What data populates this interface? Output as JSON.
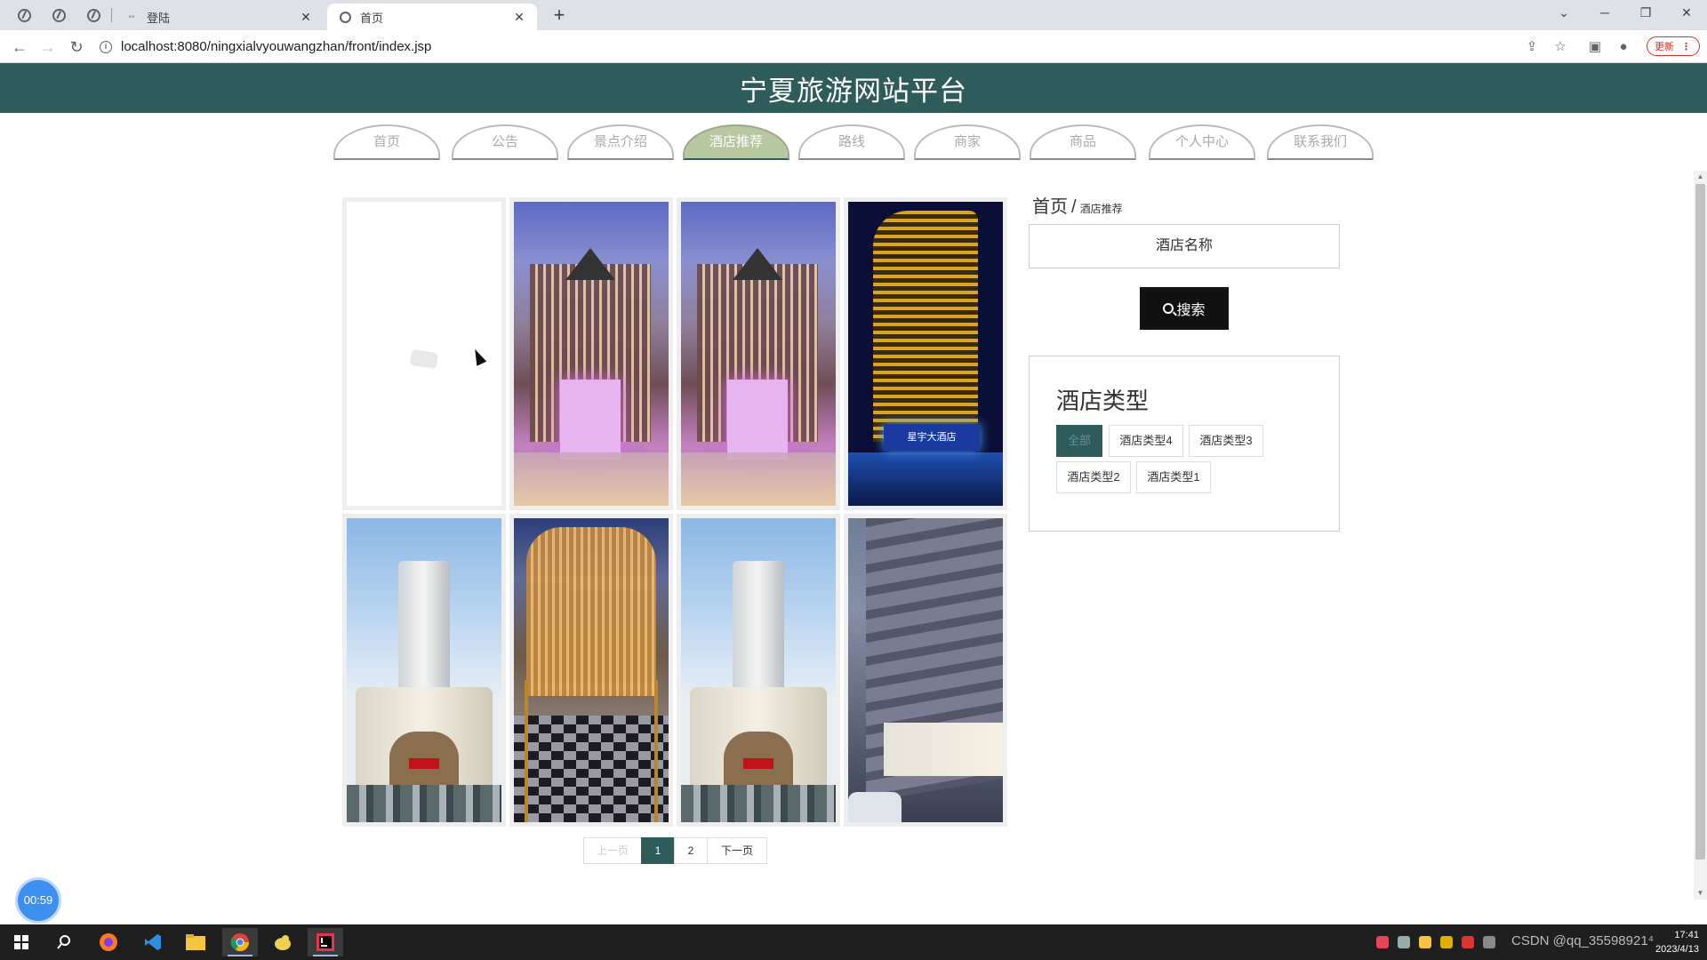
{
  "browser": {
    "tabs": [
      {
        "label": "登陆",
        "favicon": "dots-icon"
      },
      {
        "label": "首页",
        "favicon": "globe-icon"
      }
    ],
    "url": "localhost:8080/ningxialvyouwangzhan/front/index.jsp",
    "update_label": "更新"
  },
  "site": {
    "title": "宁夏旅游网站平台",
    "accent_color": "#2e5c5a",
    "nav": [
      {
        "label": "首页",
        "active": false
      },
      {
        "label": "公告",
        "active": false
      },
      {
        "label": "景点介绍",
        "active": false
      },
      {
        "label": "酒店推荐",
        "active": true
      },
      {
        "label": "路线",
        "active": false
      },
      {
        "label": "商家",
        "active": false
      },
      {
        "label": "商品",
        "active": false
      },
      {
        "label": "个人中心",
        "active": false
      },
      {
        "label": "联系我们",
        "active": false
      }
    ]
  },
  "hotels": [
    {
      "image": "blank-image"
    },
    {
      "image": "hotel-night-facade"
    },
    {
      "image": "hotel-night-facade"
    },
    {
      "image": "hotel-golden-tower",
      "sign": "星宇大酒店"
    },
    {
      "image": "hotel-white-tower"
    },
    {
      "image": "hotel-palace"
    },
    {
      "image": "hotel-white-tower"
    },
    {
      "image": "hotel-street-building"
    }
  ],
  "pagination": {
    "prev": "上一页",
    "pages": [
      "1",
      "2"
    ],
    "current": "1",
    "next": "下一页"
  },
  "sidebar": {
    "breadcrumb_home": "首页",
    "breadcrumb_sep": "/",
    "breadcrumb_current": "酒店推荐",
    "search_placeholder": "酒店名称",
    "search_button": "搜索",
    "type_title": "酒店类型",
    "types": [
      {
        "label": "全部",
        "active": true
      },
      {
        "label": "酒店类型4",
        "active": false
      },
      {
        "label": "酒店类型3",
        "active": false
      },
      {
        "label": "酒店类型2",
        "active": false
      },
      {
        "label": "酒店类型1",
        "active": false
      }
    ]
  },
  "timer": "00:59",
  "taskbar": {
    "clock_time": "17:41",
    "clock_date": "2023/4/13",
    "tray_text": "CSDN @qq_35598921⁴"
  }
}
